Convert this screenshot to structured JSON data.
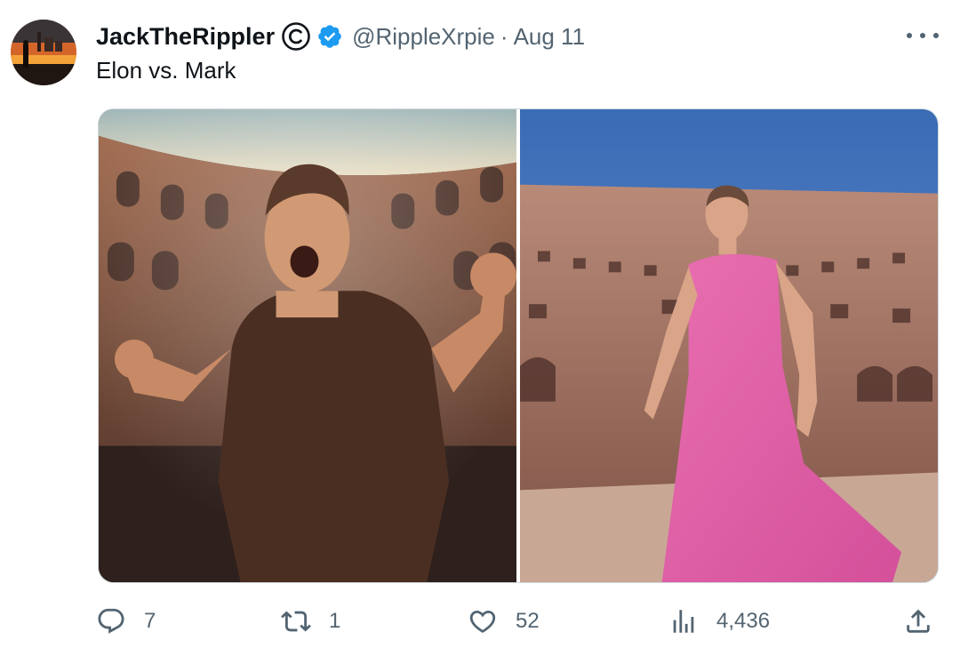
{
  "author": {
    "display_name": "JackTheRippler",
    "handle": "@RippleXrpie",
    "separator": "·",
    "date": "Aug 11",
    "verified_color": "#1d9bf0"
  },
  "tweet": {
    "text": "Elon vs. Mark"
  },
  "media": {
    "left_image": "photo-muscular-man-shouting-in-colosseum",
    "right_image": "photo-man-in-pink-dress-walking-in-colosseum"
  },
  "actions": {
    "reply_count": "7",
    "retweet_count": "1",
    "like_count": "52",
    "view_count": "4,436"
  },
  "colors": {
    "text_primary": "#0f1419",
    "text_secondary": "#536471",
    "border": "#cfd9de"
  }
}
